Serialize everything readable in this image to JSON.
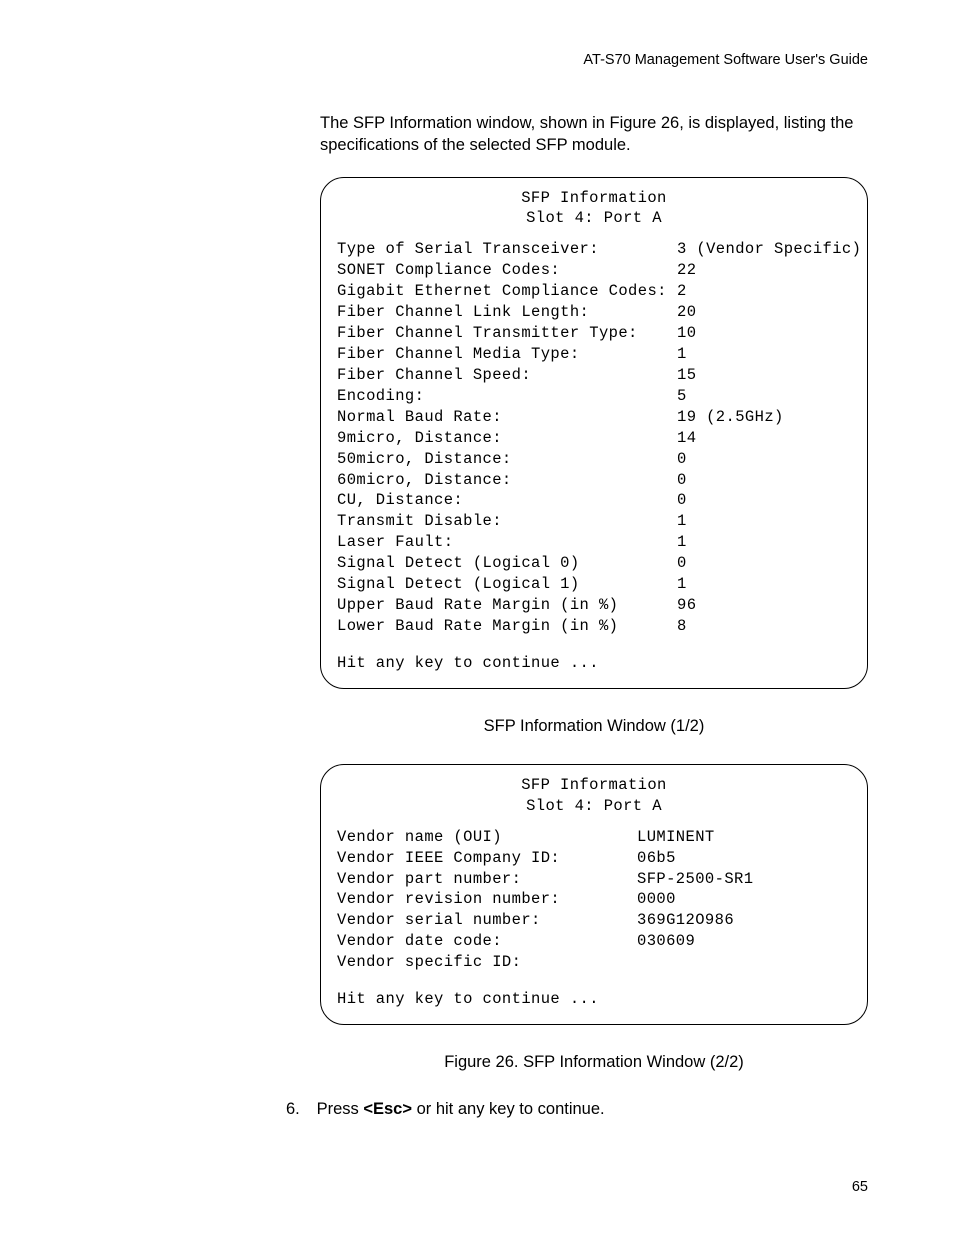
{
  "running_head": "AT-S70 Management Software User's Guide",
  "intro": "The SFP Information window, shown in Figure 26, is displayed, listing the specifications of the selected SFP module.",
  "window1": {
    "title": "SFP Information",
    "subtitle": "Slot 4: Port A",
    "rows": [
      {
        "label": "Type of Serial Transceiver:",
        "value": "3 (Vendor Specific)"
      },
      {
        "label": "SONET Compliance Codes:",
        "value": "22"
      },
      {
        "label": "Gigabit Ethernet Compliance Codes:",
        "value": "2"
      },
      {
        "label": "Fiber Channel Link Length:",
        "value": "20"
      },
      {
        "label": "Fiber Channel Transmitter Type:",
        "value": "10"
      },
      {
        "label": "Fiber Channel Media Type:",
        "value": "1"
      },
      {
        "label": "Fiber Channel Speed:",
        "value": "15"
      },
      {
        "label": "Encoding:",
        "value": "5"
      },
      {
        "label": "Normal Baud Rate:",
        "value": "19 (2.5GHz)"
      },
      {
        "label": "9micro, Distance:",
        "value": "14"
      },
      {
        "label": "50micro, Distance:",
        "value": "0"
      },
      {
        "label": "60micro, Distance:",
        "value": "0"
      },
      {
        "label": "CU, Distance:",
        "value": "0"
      },
      {
        "label": "Transmit Disable:",
        "value": "1"
      },
      {
        "label": "Laser Fault:",
        "value": "1"
      },
      {
        "label": "Signal Detect (Logical 0)",
        "value": "0"
      },
      {
        "label": "Signal Detect (Logical 1)",
        "value": "1"
      },
      {
        "label": "Upper Baud Rate Margin (in %)",
        "value": "96"
      },
      {
        "label": "Lower Baud Rate Margin (in %)",
        "value": "8"
      }
    ],
    "footer": "Hit any key to continue ..."
  },
  "caption1": "SFP Information Window (1/2)",
  "window2": {
    "title": "SFP Information",
    "subtitle": "Slot 4: Port A",
    "rows": [
      {
        "label": "Vendor name (OUI)",
        "value": "LUMINENT"
      },
      {
        "label": "Vendor IEEE Company ID:",
        "value": "06b5"
      },
      {
        "label": "Vendor part number:",
        "value": "SFP-2500-SR1"
      },
      {
        "label": "Vendor revision number:",
        "value": "0000"
      },
      {
        "label": "Vendor serial number:",
        "value": "369G12O986"
      },
      {
        "label": "Vendor date code:",
        "value": "030609"
      },
      {
        "label": "Vendor specific ID:",
        "value": ""
      }
    ],
    "footer": "Hit any key to continue ..."
  },
  "caption2": "Figure 26. SFP Information Window (2/2)",
  "step": {
    "number": "6.",
    "text_before": "Press ",
    "key": "<Esc>",
    "text_after": " or hit any key to continue."
  },
  "page_number": "65"
}
